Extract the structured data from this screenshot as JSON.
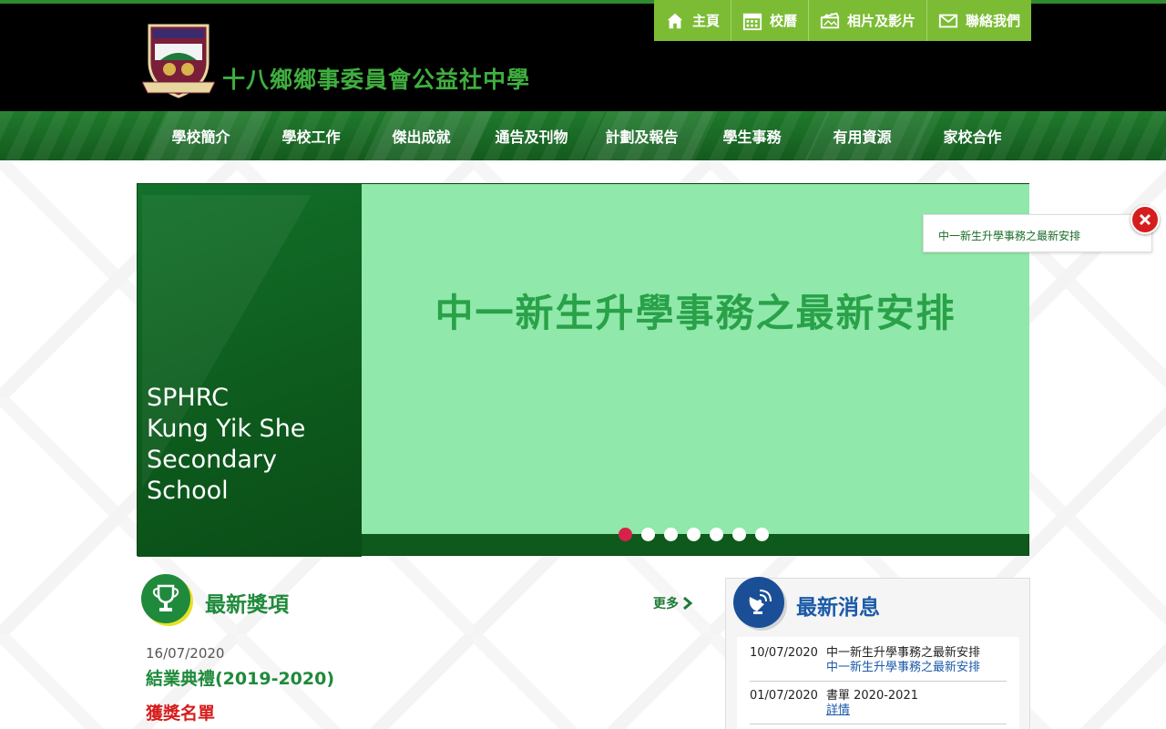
{
  "header": {
    "school_name": "十八鄉鄉事委員會公益社中學"
  },
  "toolbar": {
    "items": [
      {
        "label": "主頁",
        "icon": "home-icon"
      },
      {
        "label": "校曆",
        "icon": "calendar-icon"
      },
      {
        "label": "相片及影片",
        "icon": "photo-video-icon"
      },
      {
        "label": "聯絡我們",
        "icon": "mail-icon"
      }
    ]
  },
  "nav": {
    "items": [
      "學校簡介",
      "學校工作",
      "傑出成就",
      "通告及刊物",
      "計劃及報告",
      "學生事務",
      "有用資源",
      "家校合作"
    ]
  },
  "banner": {
    "school_english": "SPHRC\nKung Yik She\nSecondary\nSchool",
    "slide_title": "中一新生升學事務之最新安排",
    "dots_count": 7,
    "active_dot": 0
  },
  "popup": {
    "link_text": "中一新生升學事務之最新安排"
  },
  "awards": {
    "title": "最新獎項",
    "more_label": "更多",
    "date": "16/07/2020",
    "name": "結業典禮(2019-2020)",
    "list_label": "獲獎名單"
  },
  "news": {
    "title": "最新消息",
    "items": [
      {
        "date": "10/07/2020",
        "title": "中一新生升學事務之最新安排",
        "link": "中一新生升學事務之最新安排"
      },
      {
        "date": "01/07/2020",
        "title": "書單 2020-2021",
        "link": "詳情"
      }
    ]
  },
  "colors": {
    "top_accent": "#2e8b2e",
    "toolbar_green": "#7cbc34",
    "nav_green": "#1f7a2b",
    "slide_bg": "#90e8aa",
    "active_dot": "#d6224a",
    "news_blue": "#1a5aa8"
  }
}
